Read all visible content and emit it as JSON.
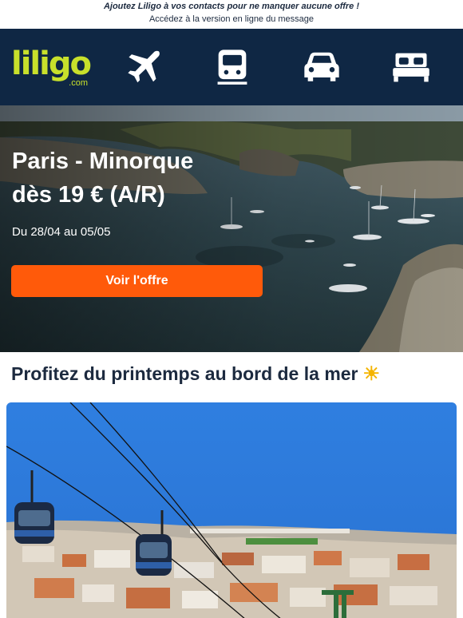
{
  "preheader": {
    "line1": "Ajoutez Liligo à vos contacts pour ne manquer aucune offre !",
    "prefix": "Accédez à la ",
    "link": "version en ligne du message"
  },
  "brand": {
    "wordmark": "liligo",
    "domain": ".com",
    "primary_color": "#c8e02b",
    "nav_bg": "#0f2744",
    "cta_color": "#ff5a0a"
  },
  "nav": {
    "items": [
      {
        "name": "flights",
        "icon": "airplane-icon"
      },
      {
        "name": "trains",
        "icon": "train-icon"
      },
      {
        "name": "cars",
        "icon": "car-icon"
      },
      {
        "name": "hotels",
        "icon": "bed-icon"
      }
    ]
  },
  "hero": {
    "title_line1": "Paris - Minorque",
    "title_line2": "dès 19 € (A/R)",
    "dates": "Du 28/04 au 05/05",
    "cta": "Voir l'offre"
  },
  "section": {
    "title": "Profitez du printemps au bord de la mer",
    "emoji": "☀️"
  }
}
